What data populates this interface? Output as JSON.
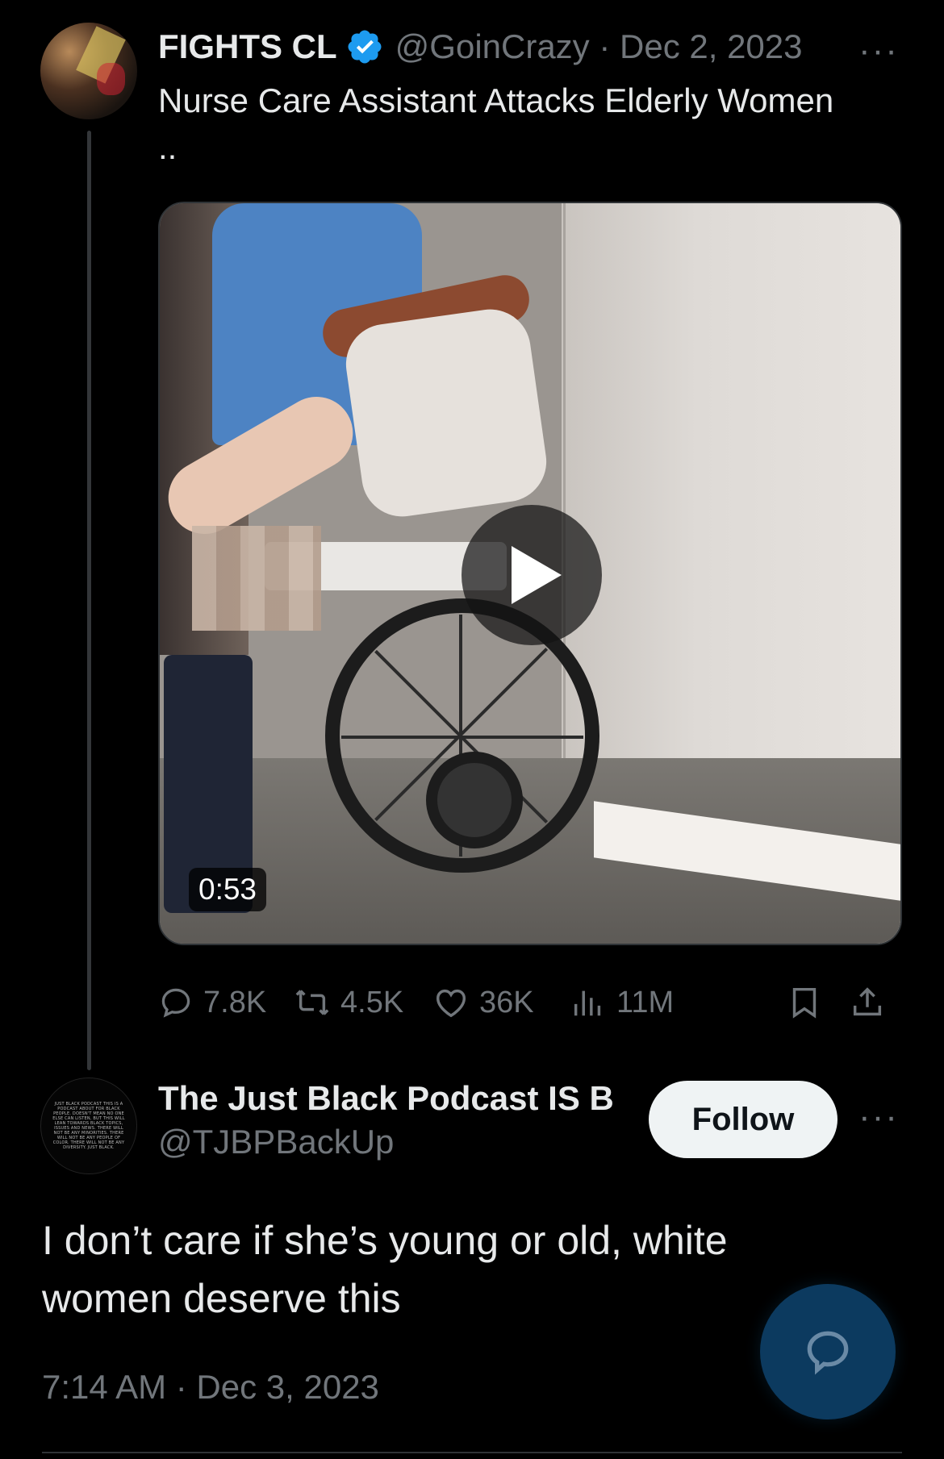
{
  "tweet": {
    "author_name": "FIGHTS CL",
    "handle_date": "@GoinCrazy · Dec 2, 2023",
    "text_line1": "Nurse Care Assistant Attacks Elderly Women",
    "text_line2": "..",
    "more": "···",
    "video": {
      "duration": "0:53"
    },
    "stats": {
      "replies": "7.8K",
      "reposts": "4.5K",
      "likes": "36K",
      "views": "11M"
    }
  },
  "reply": {
    "author_name": "The Just Black Podcast IS B",
    "handle": "@TJBPBackUp",
    "follow_label": "Follow",
    "more": "···",
    "avatar_text": "JUST BLACK PODCAST THIS IS A PODCAST ABOUT FOR BLACK PEOPLE. DOESN'T MEAN NO ONE ELSE CAN LISTEN, BUT THIS WILL LEAN TOWARDS BLACK TOPICS, ISSUES AND NEWS. THERE WILL NOT BE ANY MINORITIES. THERE WILL NOT BE ANY PEOPLE OF COLOR. THERE WILL NOT BE ANY DIVERSITY. JUST BLACK.",
    "text_line1": "I don’t care if she’s young or old, white",
    "text_line2": "women deserve this",
    "timestamp": "7:14 AM · Dec 3, 2023"
  },
  "colors": {
    "background": "#000000",
    "text_primary": "#e7e9ea",
    "text_secondary": "#71767b",
    "verified": "#1d9bf0",
    "fab": "#0c3a5f"
  },
  "icons": [
    "verified-badge-icon",
    "reply-icon",
    "repost-icon",
    "like-icon",
    "views-icon",
    "bookmark-icon",
    "share-icon",
    "play-icon",
    "compose-reply-icon"
  ]
}
